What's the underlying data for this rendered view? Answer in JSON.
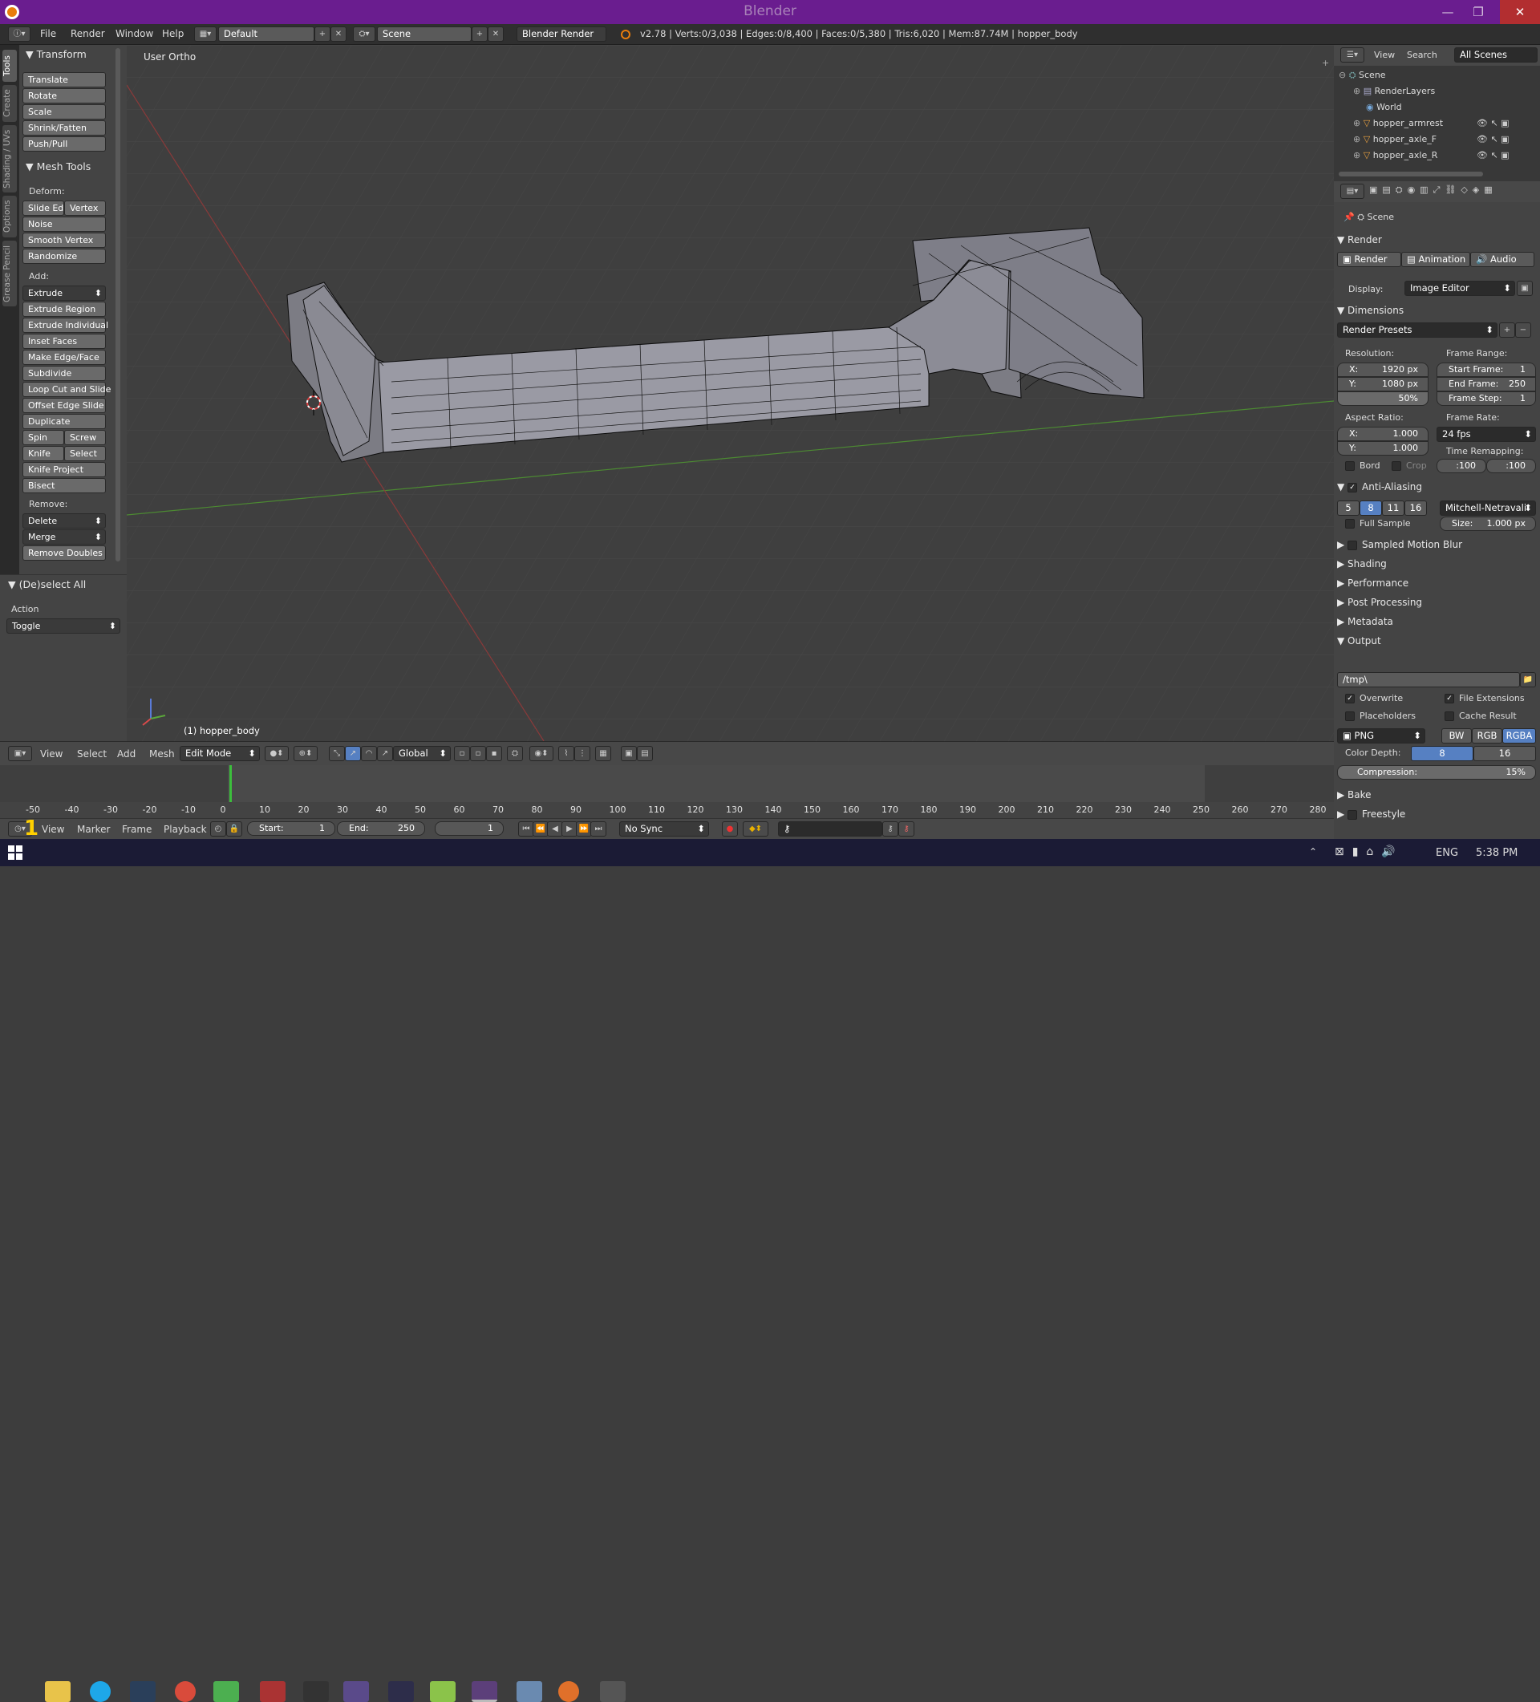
{
  "app": {
    "title": "Blender"
  },
  "menubar": {
    "items": [
      "File",
      "Render",
      "Window",
      "Help"
    ],
    "layout": "Default",
    "scene": "Scene",
    "engine": "Blender Render",
    "stats": "v2.78 | Verts:0/3,038 | Edges:0/8,400 | Faces:0/5,380 | Tris:6,020 | Mem:87.74M | hopper_body"
  },
  "tabs": [
    "Tools",
    "Create",
    "Shading / UVs",
    "Options",
    "Grease Pencil"
  ],
  "toolshelf": {
    "transform_header": "Transform",
    "transform": [
      "Translate",
      "Rotate",
      "Scale",
      "Shrink/Fatten",
      "Push/Pull"
    ],
    "meshtools_header": "Mesh Tools",
    "deform_label": "Deform:",
    "slide_edge": "Slide Ed",
    "vertex": "Vertex",
    "deform": [
      "Noise",
      "Smooth Vertex",
      "Randomize"
    ],
    "add_label": "Add:",
    "extrude": "Extrude",
    "add": [
      "Extrude Region",
      "Extrude Individual",
      "Inset Faces",
      "Make Edge/Face",
      "Subdivide",
      "Loop Cut and Slide",
      "Offset Edge Slide",
      "Duplicate"
    ],
    "spin": "Spin",
    "screw": "Screw",
    "knife": "Knife",
    "select": "Select",
    "add2": [
      "Knife Project",
      "Bisect"
    ],
    "remove_label": "Remove:",
    "delete": "Delete",
    "merge": "Merge",
    "remove_doubles": "Remove Doubles"
  },
  "operator": {
    "header": "(De)select All",
    "action_label": "Action",
    "action_value": "Toggle"
  },
  "viewport": {
    "view_label": "User Ortho",
    "object_label": "(1) hopper_body"
  },
  "viewheader": {
    "items": [
      "View",
      "Select",
      "Add",
      "Mesh"
    ],
    "mode": "Edit Mode",
    "orientation": "Global"
  },
  "timeline": {
    "ticks": [
      "-50",
      "-40",
      "-30",
      "-20",
      "-10",
      "0",
      "10",
      "20",
      "30",
      "40",
      "50",
      "60",
      "70",
      "80",
      "90",
      "100",
      "110",
      "120",
      "130",
      "140",
      "150",
      "160",
      "170",
      "180",
      "190",
      "200",
      "210",
      "220",
      "230",
      "240",
      "250",
      "260",
      "270",
      "280"
    ],
    "current_frame_value": 1,
    "menus": [
      "View",
      "Marker",
      "Frame",
      "Playback"
    ],
    "start": "Start:",
    "start_val": "1",
    "end": "End:",
    "end_val": "250",
    "cur": "1",
    "sync": "No Sync"
  },
  "outliner": {
    "menus": [
      "View",
      "Search"
    ],
    "filter": "All Scenes",
    "rows": [
      "Scene",
      "RenderLayers",
      "World",
      "hopper_armrest",
      "hopper_axle_F",
      "hopper_axle_R"
    ]
  },
  "props": {
    "context": "Scene",
    "render_header": "Render",
    "render_btn": "Render",
    "anim_btn": "Animation",
    "audio_btn": "Audio",
    "display_label": "Display:",
    "display_val": "Image Editor",
    "dims_header": "Dimensions",
    "presets": "Render Presets",
    "res_label": "Resolution:",
    "res_x": "1920 px",
    "res_y": "1080 px",
    "res_pct": "50%",
    "fr_label": "Frame Range:",
    "start_k": "Start Frame:",
    "start_v": "1",
    "end_k": "End Frame:",
    "end_v": "250",
    "step_k": "Frame Step:",
    "step_v": "1",
    "aspect_label": "Aspect Ratio:",
    "ax": "1.000",
    "ay": "1.000",
    "rate_label": "Frame Rate:",
    "rate_val": "24 fps",
    "remap_label": "Time Remapping:",
    "remap_a": ":100",
    "remap_b": ":100",
    "bord": "Bord",
    "crop": "Crop",
    "aa_header": "Anti-Aliasing",
    "aa_vals": [
      "5",
      "8",
      "11",
      "16"
    ],
    "aa_filter": "Mitchell-Netravali",
    "full_sample": "Full Sample",
    "size_k": "Size:",
    "size_v": "1.000 px",
    "collapsed": [
      "Sampled Motion Blur",
      "Shading",
      "Performance",
      "Post Processing",
      "Metadata"
    ],
    "output_header": "Output",
    "path": "/tmp\\",
    "overwrite": "Overwrite",
    "file_ext": "File Extensions",
    "placeholders": "Placeholders",
    "cache": "Cache Result",
    "format": "PNG",
    "bw": "BW",
    "rgb": "RGB",
    "rgba": "RGBA",
    "depth_label": "Color Depth:",
    "depth_8": "8",
    "depth_16": "16",
    "compression": "Compression:",
    "compression_v": "15%",
    "bake": "Bake",
    "freestyle": "Freestyle"
  },
  "taskbar": {
    "lang": "ENG",
    "time": "5:38 PM"
  },
  "colors": {
    "title": "#6a1d8f",
    "accent": "#5680c2",
    "grid_green": "#4c8a32",
    "grid_red": "#8a3a3a"
  }
}
